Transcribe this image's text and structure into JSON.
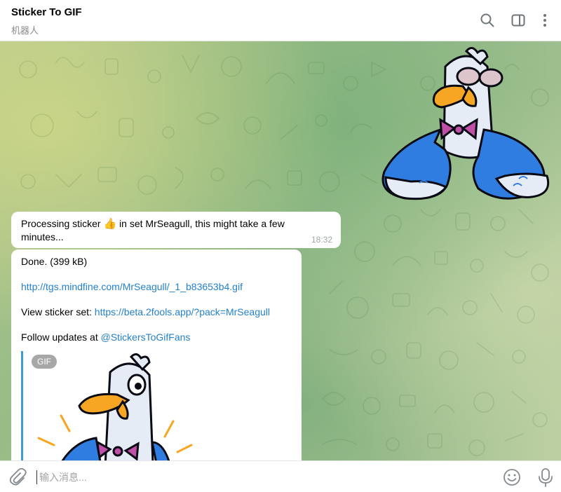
{
  "header": {
    "title": "Sticker To GIF",
    "subtitle": "机器人",
    "icons": [
      "search-icon",
      "sidebar-toggle-icon",
      "more-vertical-icon"
    ]
  },
  "sticker": {
    "name": "seagull-sticker",
    "description_icon": "seagull-sticker-icon"
  },
  "messages": [
    {
      "text_before": "Processing sticker ",
      "emoji": "👍",
      "text_after": " in set MrSeagull, this might take a few minutes...",
      "time": "18:32"
    },
    {
      "done": "Done. (399 kB)",
      "gif_link": "http://tgs.mindfine.com/MrSeagull/_1_b83653b4.gif",
      "view_label": "View sticker set: ",
      "view_link": "https://beta.2fools.app/?pack=MrSeagull",
      "follow_label": "Follow updates at ",
      "follow_link": "@StickersToGifFans",
      "gif_badge": "GIF"
    }
  ],
  "composer": {
    "placeholder": "输入消息..."
  },
  "colors": {
    "link": "#2481cc",
    "accent_bar": "#3a9bd8",
    "bubble": "#ffffff"
  }
}
